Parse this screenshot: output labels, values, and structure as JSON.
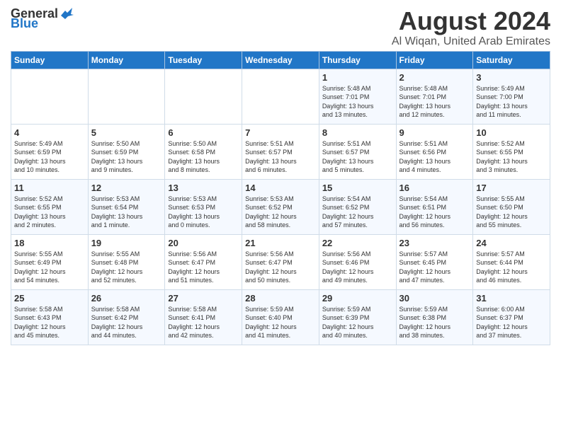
{
  "logo": {
    "general": "General",
    "blue": "Blue"
  },
  "title": "August 2024",
  "subtitle": "Al Wiqan, United Arab Emirates",
  "days_of_week": [
    "Sunday",
    "Monday",
    "Tuesday",
    "Wednesday",
    "Thursday",
    "Friday",
    "Saturday"
  ],
  "weeks": [
    [
      {
        "day": "",
        "content": ""
      },
      {
        "day": "",
        "content": ""
      },
      {
        "day": "",
        "content": ""
      },
      {
        "day": "",
        "content": ""
      },
      {
        "day": "1",
        "content": "Sunrise: 5:48 AM\nSunset: 7:01 PM\nDaylight: 13 hours\nand 13 minutes."
      },
      {
        "day": "2",
        "content": "Sunrise: 5:48 AM\nSunset: 7:01 PM\nDaylight: 13 hours\nand 12 minutes."
      },
      {
        "day": "3",
        "content": "Sunrise: 5:49 AM\nSunset: 7:00 PM\nDaylight: 13 hours\nand 11 minutes."
      }
    ],
    [
      {
        "day": "4",
        "content": "Sunrise: 5:49 AM\nSunset: 6:59 PM\nDaylight: 13 hours\nand 10 minutes."
      },
      {
        "day": "5",
        "content": "Sunrise: 5:50 AM\nSunset: 6:59 PM\nDaylight: 13 hours\nand 9 minutes."
      },
      {
        "day": "6",
        "content": "Sunrise: 5:50 AM\nSunset: 6:58 PM\nDaylight: 13 hours\nand 8 minutes."
      },
      {
        "day": "7",
        "content": "Sunrise: 5:51 AM\nSunset: 6:57 PM\nDaylight: 13 hours\nand 6 minutes."
      },
      {
        "day": "8",
        "content": "Sunrise: 5:51 AM\nSunset: 6:57 PM\nDaylight: 13 hours\nand 5 minutes."
      },
      {
        "day": "9",
        "content": "Sunrise: 5:51 AM\nSunset: 6:56 PM\nDaylight: 13 hours\nand 4 minutes."
      },
      {
        "day": "10",
        "content": "Sunrise: 5:52 AM\nSunset: 6:55 PM\nDaylight: 13 hours\nand 3 minutes."
      }
    ],
    [
      {
        "day": "11",
        "content": "Sunrise: 5:52 AM\nSunset: 6:55 PM\nDaylight: 13 hours\nand 2 minutes."
      },
      {
        "day": "12",
        "content": "Sunrise: 5:53 AM\nSunset: 6:54 PM\nDaylight: 13 hours\nand 1 minute."
      },
      {
        "day": "13",
        "content": "Sunrise: 5:53 AM\nSunset: 6:53 PM\nDaylight: 13 hours\nand 0 minutes."
      },
      {
        "day": "14",
        "content": "Sunrise: 5:53 AM\nSunset: 6:52 PM\nDaylight: 12 hours\nand 58 minutes."
      },
      {
        "day": "15",
        "content": "Sunrise: 5:54 AM\nSunset: 6:52 PM\nDaylight: 12 hours\nand 57 minutes."
      },
      {
        "day": "16",
        "content": "Sunrise: 5:54 AM\nSunset: 6:51 PM\nDaylight: 12 hours\nand 56 minutes."
      },
      {
        "day": "17",
        "content": "Sunrise: 5:55 AM\nSunset: 6:50 PM\nDaylight: 12 hours\nand 55 minutes."
      }
    ],
    [
      {
        "day": "18",
        "content": "Sunrise: 5:55 AM\nSunset: 6:49 PM\nDaylight: 12 hours\nand 54 minutes."
      },
      {
        "day": "19",
        "content": "Sunrise: 5:55 AM\nSunset: 6:48 PM\nDaylight: 12 hours\nand 52 minutes."
      },
      {
        "day": "20",
        "content": "Sunrise: 5:56 AM\nSunset: 6:47 PM\nDaylight: 12 hours\nand 51 minutes."
      },
      {
        "day": "21",
        "content": "Sunrise: 5:56 AM\nSunset: 6:47 PM\nDaylight: 12 hours\nand 50 minutes."
      },
      {
        "day": "22",
        "content": "Sunrise: 5:56 AM\nSunset: 6:46 PM\nDaylight: 12 hours\nand 49 minutes."
      },
      {
        "day": "23",
        "content": "Sunrise: 5:57 AM\nSunset: 6:45 PM\nDaylight: 12 hours\nand 47 minutes."
      },
      {
        "day": "24",
        "content": "Sunrise: 5:57 AM\nSunset: 6:44 PM\nDaylight: 12 hours\nand 46 minutes."
      }
    ],
    [
      {
        "day": "25",
        "content": "Sunrise: 5:58 AM\nSunset: 6:43 PM\nDaylight: 12 hours\nand 45 minutes."
      },
      {
        "day": "26",
        "content": "Sunrise: 5:58 AM\nSunset: 6:42 PM\nDaylight: 12 hours\nand 44 minutes."
      },
      {
        "day": "27",
        "content": "Sunrise: 5:58 AM\nSunset: 6:41 PM\nDaylight: 12 hours\nand 42 minutes."
      },
      {
        "day": "28",
        "content": "Sunrise: 5:59 AM\nSunset: 6:40 PM\nDaylight: 12 hours\nand 41 minutes."
      },
      {
        "day": "29",
        "content": "Sunrise: 5:59 AM\nSunset: 6:39 PM\nDaylight: 12 hours\nand 40 minutes."
      },
      {
        "day": "30",
        "content": "Sunrise: 5:59 AM\nSunset: 6:38 PM\nDaylight: 12 hours\nand 38 minutes."
      },
      {
        "day": "31",
        "content": "Sunrise: 6:00 AM\nSunset: 6:37 PM\nDaylight: 12 hours\nand 37 minutes."
      }
    ]
  ]
}
